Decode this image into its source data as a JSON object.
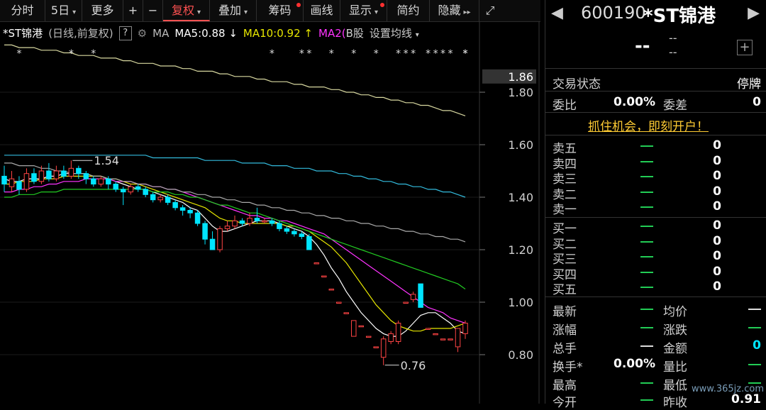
{
  "toolbar": {
    "items": [
      {
        "label": "分时"
      },
      {
        "label": "5日"
      },
      {
        "label": "更多"
      },
      {
        "label": "+"
      },
      {
        "label": "−"
      },
      {
        "label": "复权"
      },
      {
        "label": "叠加"
      },
      {
        "label": "筹码"
      },
      {
        "label": "画线"
      },
      {
        "label": "显示"
      },
      {
        "label": "简约"
      },
      {
        "label": "隐藏"
      }
    ],
    "active": "复权",
    "accent": "#ff5252"
  },
  "legend": {
    "name": "*ST锦港",
    "mode": "(日线,前复权)",
    "help": "?",
    "ma_label": "MA",
    "ma5": "MA5:0.88",
    "ma5_arrow": "↓",
    "ma10": "MA10:0.92",
    "ma10_arrow": "↑",
    "ma20": "MA2(",
    "cut": "B股",
    "settings": "设置均线",
    "colors": {
      "ma5": "#ffffff",
      "ma10": "#e6e600",
      "ma20": "#ff33ff"
    }
  },
  "axis": {
    "ticks": [
      "1.80",
      "1.60",
      "1.40",
      "1.20",
      "1.00",
      "0.80"
    ],
    "current_price_tag": "1.86"
  },
  "annotations": {
    "high": "1.54",
    "low": "0.76"
  },
  "chart_data": {
    "type": "candlestick",
    "ylim": [
      0.72,
      2.05
    ],
    "y_ticks": [
      1.8,
      1.6,
      1.4,
      1.2,
      1.0,
      0.8
    ],
    "high_marker": 1.54,
    "low_marker": 0.76,
    "candles": [
      [
        1.48,
        1.45,
        1.52,
        1.42
      ],
      [
        1.44,
        1.47,
        1.5,
        1.42
      ],
      [
        1.46,
        1.43,
        1.48,
        1.41
      ],
      [
        1.43,
        1.49,
        1.51,
        1.42
      ],
      [
        1.49,
        1.46,
        1.51,
        1.45
      ],
      [
        1.46,
        1.5,
        1.52,
        1.45
      ],
      [
        1.5,
        1.47,
        1.53,
        1.46
      ],
      [
        1.47,
        1.5,
        1.52,
        1.46
      ],
      [
        1.5,
        1.48,
        1.52,
        1.47
      ],
      [
        1.48,
        1.51,
        1.54,
        1.47
      ],
      [
        1.51,
        1.49,
        1.52,
        1.47
      ],
      [
        1.49,
        1.47,
        1.5,
        1.45
      ],
      [
        1.47,
        1.45,
        1.48,
        1.44
      ],
      [
        1.45,
        1.47,
        1.48,
        1.44
      ],
      [
        1.47,
        1.45,
        1.48,
        1.43
      ],
      [
        1.45,
        1.43,
        1.46,
        1.42
      ],
      [
        1.43,
        1.42,
        1.44,
        1.37
      ],
      [
        1.42,
        1.44,
        1.45,
        1.41
      ],
      [
        1.44,
        1.43,
        1.45,
        1.42
      ],
      [
        1.43,
        1.41,
        1.44,
        1.4
      ],
      [
        1.41,
        1.39,
        1.42,
        1.38
      ],
      [
        1.39,
        1.4,
        1.41,
        1.38
      ],
      [
        1.4,
        1.38,
        1.41,
        1.37
      ],
      [
        1.38,
        1.36,
        1.39,
        1.35
      ],
      [
        1.36,
        1.35,
        1.37,
        1.33
      ],
      [
        1.35,
        1.34,
        1.36,
        1.32
      ],
      [
        1.34,
        1.3,
        1.35,
        1.29
      ],
      [
        1.3,
        1.24,
        1.31,
        1.22
      ],
      [
        1.24,
        1.2,
        1.27,
        1.2
      ],
      [
        1.2,
        1.28,
        1.29,
        1.19
      ],
      [
        1.28,
        1.29,
        1.31,
        1.27
      ],
      [
        1.29,
        1.31,
        1.33,
        1.28
      ],
      [
        1.31,
        1.3,
        1.32,
        1.29
      ],
      [
        1.3,
        1.32,
        1.34,
        1.29
      ],
      [
        1.32,
        1.31,
        1.36,
        1.3
      ],
      [
        1.31,
        1.31,
        1.32,
        1.3
      ],
      [
        1.31,
        1.3,
        1.32,
        1.29
      ],
      [
        1.3,
        1.28,
        1.31,
        1.27
      ],
      [
        1.28,
        1.27,
        1.29,
        1.26
      ],
      [
        1.27,
        1.26,
        1.28,
        1.25
      ],
      [
        1.26,
        1.25,
        1.27,
        1.24
      ],
      [
        1.25,
        1.2,
        1.26,
        1.2
      ],
      [
        1.15,
        1.15,
        1.15,
        1.15
      ],
      [
        1.1,
        1.1,
        1.1,
        1.1
      ],
      [
        1.05,
        1.05,
        1.05,
        1.05
      ],
      [
        1.0,
        1.0,
        1.0,
        1.0
      ],
      [
        0.96,
        0.96,
        0.96,
        0.96
      ],
      [
        0.87,
        0.93,
        0.93,
        0.87
      ],
      [
        0.91,
        0.91,
        0.91,
        0.91
      ],
      [
        0.87,
        0.87,
        0.87,
        0.87
      ],
      [
        0.83,
        0.83,
        0.83,
        0.83
      ],
      [
        0.79,
        0.86,
        0.87,
        0.76
      ],
      [
        0.85,
        0.88,
        0.89,
        0.84
      ],
      [
        0.85,
        0.92,
        0.93,
        0.84
      ],
      [
        1.0,
        1.0,
        1.0,
        1.0
      ],
      [
        1.01,
        1.03,
        1.04,
        1.0
      ],
      [
        1.07,
        0.98,
        1.07,
        0.98
      ],
      [
        0.9,
        0.9,
        0.9,
        0.9
      ],
      [
        0.88,
        0.88,
        0.88,
        0.88
      ],
      [
        0.86,
        0.86,
        0.86,
        0.86
      ],
      [
        0.86,
        0.86,
        0.86,
        0.86
      ],
      [
        0.83,
        0.9,
        0.9,
        0.81
      ],
      [
        0.88,
        0.92,
        0.93,
        0.86
      ]
    ],
    "ma_series": [
      {
        "name": "MA5",
        "color": "#ffffff",
        "values": [
          1.47,
          1.46,
          1.46,
          1.47,
          1.47,
          1.47,
          1.48,
          1.48,
          1.49,
          1.49,
          1.49,
          1.49,
          1.48,
          1.48,
          1.47,
          1.46,
          1.45,
          1.44,
          1.43,
          1.43,
          1.42,
          1.41,
          1.4,
          1.39,
          1.38,
          1.36,
          1.35,
          1.32,
          1.29,
          1.27,
          1.27,
          1.28,
          1.29,
          1.3,
          1.31,
          1.31,
          1.31,
          1.3,
          1.29,
          1.28,
          1.27,
          1.25,
          1.22,
          1.18,
          1.13,
          1.09,
          1.04,
          1.0,
          0.96,
          0.93,
          0.9,
          0.88,
          0.87,
          0.87,
          0.89,
          0.92,
          0.95,
          0.96,
          0.96,
          0.94,
          0.92,
          0.89,
          0.88
        ]
      },
      {
        "name": "MA10",
        "color": "#e6e600",
        "values": [
          1.45,
          1.45,
          1.46,
          1.46,
          1.46,
          1.47,
          1.47,
          1.47,
          1.48,
          1.48,
          1.48,
          1.48,
          1.48,
          1.48,
          1.47,
          1.47,
          1.46,
          1.45,
          1.45,
          1.44,
          1.43,
          1.42,
          1.41,
          1.4,
          1.39,
          1.38,
          1.37,
          1.36,
          1.34,
          1.32,
          1.31,
          1.31,
          1.3,
          1.3,
          1.3,
          1.3,
          1.3,
          1.3,
          1.29,
          1.29,
          1.28,
          1.27,
          1.25,
          1.23,
          1.21,
          1.18,
          1.15,
          1.11,
          1.07,
          1.03,
          0.99,
          0.96,
          0.93,
          0.91,
          0.9,
          0.89,
          0.89,
          0.9,
          0.9,
          0.9,
          0.9,
          0.91,
          0.92
        ]
      },
      {
        "name": "MA20",
        "color": "#ff33ff",
        "values": [
          1.42,
          1.42,
          1.43,
          1.43,
          1.44,
          1.44,
          1.45,
          1.45,
          1.46,
          1.46,
          1.46,
          1.47,
          1.47,
          1.47,
          1.47,
          1.46,
          1.46,
          1.46,
          1.45,
          1.45,
          1.44,
          1.44,
          1.43,
          1.43,
          1.42,
          1.41,
          1.4,
          1.39,
          1.38,
          1.37,
          1.36,
          1.35,
          1.34,
          1.33,
          1.33,
          1.32,
          1.32,
          1.31,
          1.31,
          1.3,
          1.29,
          1.28,
          1.27,
          1.26,
          1.24,
          1.22,
          1.2,
          1.18,
          1.16,
          1.14,
          1.12,
          1.1,
          1.08,
          1.06,
          1.04,
          1.02,
          1.0,
          0.98,
          0.97,
          0.96,
          0.94,
          0.93,
          0.92
        ]
      },
      {
        "name": "MA30",
        "color": "#22cc22",
        "values": [
          1.4,
          1.4,
          1.41,
          1.41,
          1.41,
          1.42,
          1.42,
          1.42,
          1.43,
          1.43,
          1.43,
          1.43,
          1.43,
          1.43,
          1.43,
          1.43,
          1.43,
          1.43,
          1.43,
          1.43,
          1.42,
          1.42,
          1.42,
          1.41,
          1.41,
          1.4,
          1.4,
          1.39,
          1.38,
          1.37,
          1.37,
          1.36,
          1.35,
          1.34,
          1.34,
          1.33,
          1.32,
          1.31,
          1.3,
          1.29,
          1.28,
          1.27,
          1.26,
          1.25,
          1.24,
          1.23,
          1.22,
          1.21,
          1.2,
          1.19,
          1.18,
          1.17,
          1.16,
          1.15,
          1.14,
          1.13,
          1.12,
          1.11,
          1.1,
          1.09,
          1.08,
          1.07,
          1.05
        ]
      },
      {
        "name": "MA60",
        "color": "#aaaaaa",
        "values": [
          1.53,
          1.53,
          1.52,
          1.52,
          1.52,
          1.51,
          1.51,
          1.5,
          1.5,
          1.49,
          1.49,
          1.49,
          1.48,
          1.48,
          1.47,
          1.47,
          1.46,
          1.46,
          1.45,
          1.45,
          1.44,
          1.44,
          1.43,
          1.43,
          1.42,
          1.42,
          1.41,
          1.41,
          1.4,
          1.4,
          1.39,
          1.39,
          1.38,
          1.38,
          1.37,
          1.37,
          1.36,
          1.36,
          1.35,
          1.35,
          1.34,
          1.34,
          1.33,
          1.33,
          1.32,
          1.32,
          1.31,
          1.31,
          1.3,
          1.3,
          1.29,
          1.29,
          1.28,
          1.28,
          1.27,
          1.27,
          1.26,
          1.26,
          1.25,
          1.25,
          1.24,
          1.24,
          1.23
        ]
      },
      {
        "name": "MA120",
        "color": "#33bbdd",
        "values": [
          1.56,
          1.56,
          1.56,
          1.56,
          1.56,
          1.56,
          1.56,
          1.56,
          1.56,
          1.56,
          1.56,
          1.56,
          1.56,
          1.56,
          1.56,
          1.56,
          1.56,
          1.56,
          1.56,
          1.56,
          1.55,
          1.55,
          1.55,
          1.55,
          1.55,
          1.55,
          1.55,
          1.54,
          1.54,
          1.54,
          1.54,
          1.54,
          1.53,
          1.53,
          1.53,
          1.53,
          1.52,
          1.52,
          1.52,
          1.51,
          1.51,
          1.51,
          1.5,
          1.5,
          1.5,
          1.49,
          1.49,
          1.48,
          1.48,
          1.47,
          1.47,
          1.46,
          1.46,
          1.45,
          1.45,
          1.44,
          1.44,
          1.43,
          1.43,
          1.42,
          1.42,
          1.41,
          1.4
        ]
      },
      {
        "name": "MA250",
        "color": "#d8d8a0",
        "values": [
          1.98,
          1.98,
          1.97,
          1.97,
          1.97,
          1.96,
          1.96,
          1.96,
          1.95,
          1.95,
          1.94,
          1.94,
          1.94,
          1.93,
          1.93,
          1.93,
          1.92,
          1.92,
          1.91,
          1.91,
          1.91,
          1.9,
          1.9,
          1.9,
          1.89,
          1.89,
          1.88,
          1.88,
          1.88,
          1.87,
          1.87,
          1.86,
          1.86,
          1.86,
          1.85,
          1.85,
          1.84,
          1.84,
          1.84,
          1.83,
          1.83,
          1.82,
          1.82,
          1.82,
          1.81,
          1.81,
          1.8,
          1.8,
          1.79,
          1.79,
          1.78,
          1.78,
          1.77,
          1.77,
          1.76,
          1.76,
          1.75,
          1.75,
          1.74,
          1.73,
          1.73,
          1.72,
          1.71
        ]
      }
    ]
  },
  "panel": {
    "code": "600190",
    "name": "*ST锦港",
    "price": "--",
    "change_top": "--",
    "change_bottom": "--",
    "add": "+",
    "status_label": "交易状态",
    "status_value": "停牌",
    "wb_label": "委比",
    "wb_value": "0.00%",
    "wc_label": "委差",
    "wc_value": "0",
    "promo": "抓住机会，即刻开户！",
    "sell": [
      {
        "label": "卖五",
        "vol": "0"
      },
      {
        "label": "卖四",
        "vol": "0"
      },
      {
        "label": "卖三",
        "vol": "0"
      },
      {
        "label": "卖二",
        "vol": "0"
      },
      {
        "label": "卖一",
        "vol": "0"
      }
    ],
    "buy": [
      {
        "label": "买一",
        "vol": "0"
      },
      {
        "label": "买二",
        "vol": "0"
      },
      {
        "label": "买三",
        "vol": "0"
      },
      {
        "label": "买四",
        "vol": "0"
      },
      {
        "label": "买五",
        "vol": "0"
      }
    ],
    "stats": {
      "zuixin": "最新",
      "junjia": "均价",
      "zhangfu": "涨幅",
      "zhangdie": "涨跌",
      "zongshou": "总手",
      "jine": "金额",
      "jine_value": "0",
      "huanshou": "换手*",
      "huanshou_value": "0.00%",
      "liangbi": "量比",
      "zuigao": "最高",
      "zuidi": "最低",
      "jinkai": "今开",
      "zuoshou": "昨收",
      "zuoshou_value": "0.91"
    }
  },
  "watermark": "www.365jz.com"
}
